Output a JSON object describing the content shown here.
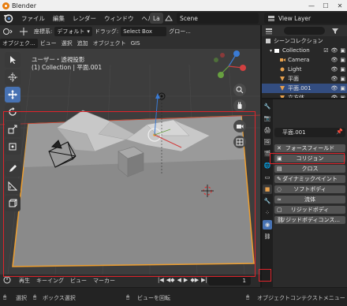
{
  "window": {
    "title": "Blender"
  },
  "menubar": {
    "items": [
      "ファイル",
      "編集",
      "レンダー",
      "ウィンドウ",
      "ヘルプ"
    ],
    "workspace_tab": "La",
    "scene": "Scene",
    "view_layer": "View Layer"
  },
  "viewport_header": {
    "mode": "オブジェク...",
    "orientation_label": "座標系:",
    "orientation_value": "デフォルト",
    "drag_label": "ドラッグ:",
    "drag_value": "Select Box",
    "global": "グロー...",
    "menus": [
      "ビュー",
      "選択",
      "追加",
      "オブジェクト",
      "GIS"
    ]
  },
  "viewport": {
    "view_name": "ユーザー・透視投影",
    "collection_info": "(1) Collection | 平面.001"
  },
  "outliner": {
    "root": "シーンコレクション",
    "collection": "Collection",
    "items": [
      {
        "label": "Camera",
        "color": "#e6a04d"
      },
      {
        "label": "Light",
        "color": "#e6a04d"
      },
      {
        "label": "平面",
        "color": "#e6a04d"
      },
      {
        "label": "平面.001",
        "color": "#e6a04d",
        "selected": true
      },
      {
        "label": "立方体",
        "color": "#e6a04d"
      }
    ]
  },
  "properties": {
    "object_name": "平面.001",
    "physics_buttons": [
      "フォースフィールド",
      "コリジョン",
      "クロス",
      "ダイナミックペイント",
      "ソフトボディ",
      "流体",
      "リジッドボディ",
      "リジッドボディコンス..."
    ],
    "highlighted": "コリジョン"
  },
  "timeline": {
    "items": [
      "再生",
      "キーイング",
      "ビュー",
      "マーカー"
    ],
    "frame": "1"
  },
  "statusbar": {
    "select": "選択",
    "box_select": "ボックス選択",
    "rotate_view": "ビューを回転",
    "context_menu": "オブジェクトコンテクストメニュー"
  },
  "colors": {
    "accent_blue": "#4772b3",
    "highlight_red": "#e0242b",
    "selection_orange": "#f0a030"
  }
}
